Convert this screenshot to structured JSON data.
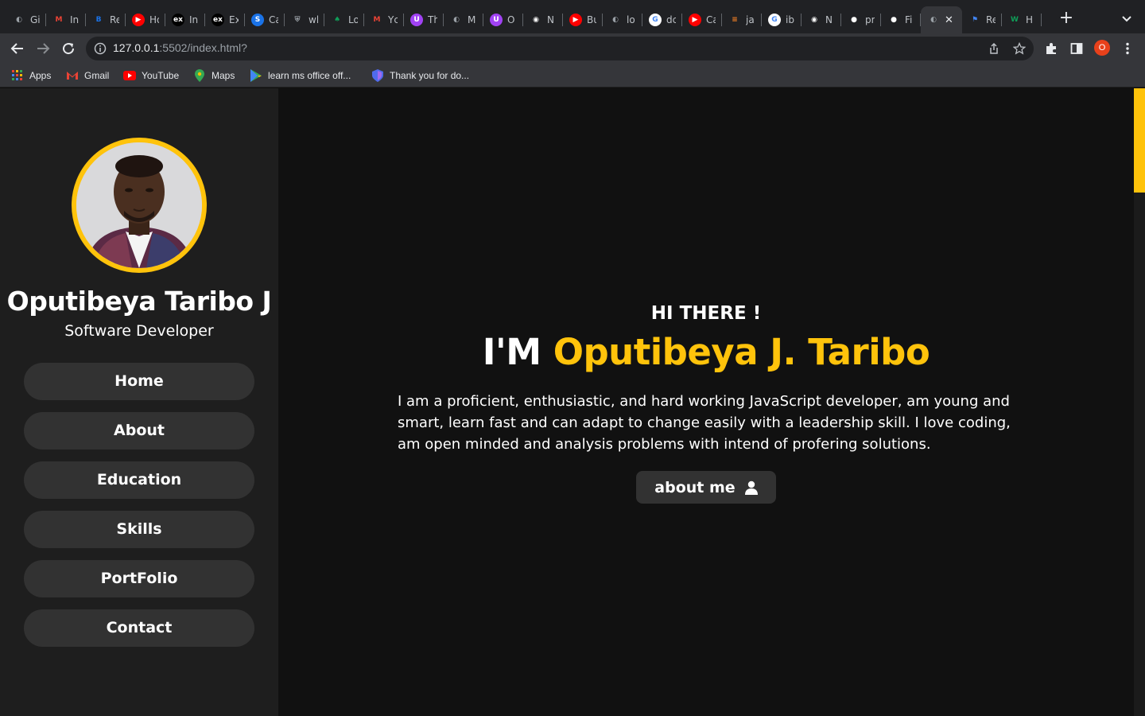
{
  "browser": {
    "tabs": [
      {
        "title": "Gi",
        "icon": "globe-icon",
        "color": "#9aa0a6"
      },
      {
        "title": "In",
        "icon": "gmail-icon",
        "color": "#ea4335"
      },
      {
        "title": "Re",
        "icon": "binance-icon",
        "color": "#1a73e8"
      },
      {
        "title": "Ho",
        "icon": "youtube-icon",
        "color": "#ff0000"
      },
      {
        "title": "In",
        "icon": "ex-icon",
        "color": "#ffffff"
      },
      {
        "title": "Ex",
        "icon": "ex-icon",
        "color": "#ffffff"
      },
      {
        "title": "Ca",
        "icon": "s-icon",
        "color": "#1a73e8"
      },
      {
        "title": "wh",
        "icon": "shield-icon",
        "color": "#9aa0a6"
      },
      {
        "title": "Lo",
        "icon": "mongo-leaf-icon",
        "color": "#0f9d58"
      },
      {
        "title": "Yc",
        "icon": "gmail-icon",
        "color": "#ea4335"
      },
      {
        "title": "Th",
        "icon": "purple-u-icon",
        "color": "#a142f4"
      },
      {
        "title": "M",
        "icon": "globe-icon",
        "color": "#9aa0a6"
      },
      {
        "title": "O",
        "icon": "purple-u-icon",
        "color": "#a142f4"
      },
      {
        "title": "N",
        "icon": "chrome-icon",
        "color": "#ffffff"
      },
      {
        "title": "Bu",
        "icon": "youtube-icon",
        "color": "#ff0000"
      },
      {
        "title": "lo",
        "icon": "globe-icon",
        "color": "#9aa0a6"
      },
      {
        "title": "dc",
        "icon": "google-icon",
        "color": "#4285f4"
      },
      {
        "title": "Ca",
        "icon": "youtube-icon",
        "color": "#ff0000"
      },
      {
        "title": "ja",
        "icon": "stackoverflow-icon",
        "color": "#f48024"
      },
      {
        "title": "ib",
        "icon": "google-icon",
        "color": "#4285f4"
      },
      {
        "title": "N",
        "icon": "chrome-icon",
        "color": "#ffffff"
      },
      {
        "title": "pr",
        "icon": "github-icon",
        "color": "#ffffff"
      },
      {
        "title": "Fi",
        "icon": "github-icon",
        "color": "#ffffff"
      },
      {
        "title": "",
        "icon": "globe-icon",
        "color": "#9aa0a6",
        "active": true
      },
      {
        "title": "Re",
        "icon": "flag-icon",
        "color": "#4285f4"
      },
      {
        "title": "H",
        "icon": "w-icon",
        "color": "#0f9d58"
      }
    ],
    "url_host": "127.0.0.1",
    "url_rest": ":5502/index.html?",
    "profile_initial": "O",
    "bookmarks": [
      {
        "label": "Apps",
        "icon": "apps-grid-icon"
      },
      {
        "label": "Gmail",
        "icon": "gmail-icon"
      },
      {
        "label": "YouTube",
        "icon": "youtube-icon"
      },
      {
        "label": "Maps",
        "icon": "maps-pin-icon"
      },
      {
        "label": "learn ms office off...",
        "icon": "play-store-icon"
      },
      {
        "label": "Thank you for do...",
        "icon": "shield-blue-icon"
      }
    ]
  },
  "sidebar": {
    "name": "Oputibeya Taribo J",
    "role": "Software Developer",
    "nav": [
      "Home",
      "About",
      "Education",
      "Skills",
      "PortFolio",
      "Contact"
    ]
  },
  "hero": {
    "greeting": "HI THERE !",
    "prefix": "I'M ",
    "highlight": "Oputibeya J. Taribo",
    "bio": "I am a proficient, enthusiastic, and hard working JavaScript developer, am young and smart, learn fast and can adapt to change easily with a leadership skill. I love coding, am open minded and analysis problems with intend of profering solutions.",
    "button": "about me"
  },
  "colors": {
    "accent": "#ffc30b",
    "page_bg": "#111111",
    "sidebar_bg": "#1e1e1e",
    "button_bg": "#323232"
  }
}
